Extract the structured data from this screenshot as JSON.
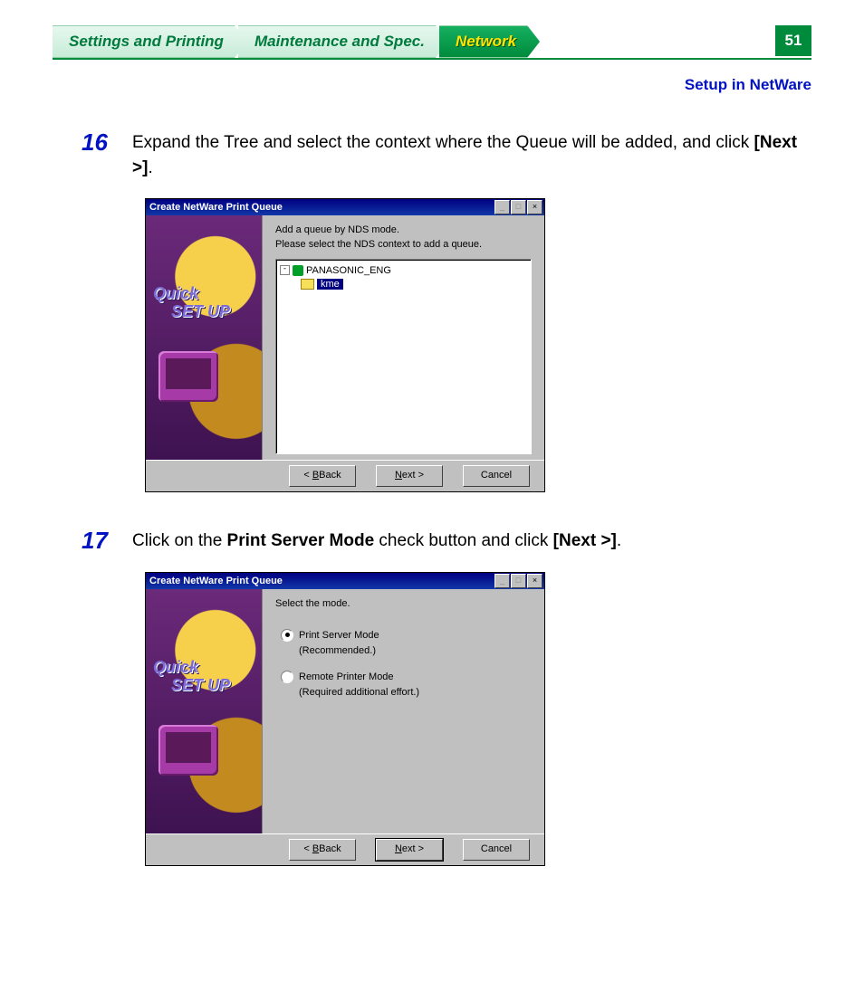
{
  "header": {
    "tabs": [
      {
        "label": "Settings and Printing"
      },
      {
        "label": "Maintenance and Spec."
      },
      {
        "label": "Network"
      }
    ],
    "page_number": "51",
    "section_title": "Setup in NetWare"
  },
  "steps": [
    {
      "num": "16",
      "pre": "Expand the Tree and select the context where the Queue will be added, and click ",
      "bold": "[Next >]",
      "post": "."
    },
    {
      "num": "17",
      "pre": "Click on the ",
      "bold": "Print Server Mode",
      "mid": " check button and click ",
      "bold2": "[Next >]",
      "post": "."
    }
  ],
  "dialog1": {
    "title": "Create NetWare Print Queue",
    "min": "_",
    "max": "□",
    "close": "×",
    "side_quick": "Quick",
    "side_setup": "SET UP",
    "instr_line1": "Add a queue by NDS mode.",
    "instr_line2": "Please select the NDS context to add a queue.",
    "tree_toggle": "-",
    "tree_root": "PANASONIC_ENG",
    "tree_child": "kme",
    "btn_back": "Back",
    "btn_back_pre": "< ",
    "btn_next": "ext >",
    "btn_next_pre": "N",
    "btn_cancel": "Cancel"
  },
  "dialog2": {
    "title": "Create NetWare Print Queue",
    "min": "_",
    "max": "□",
    "close": "×",
    "side_quick": "Quick",
    "side_setup": "SET UP",
    "instr_line1": "Select the mode.",
    "radio1_label": "Print Server Mode",
    "radio1_sub": "(Recommended.)",
    "radio2_label": "Remote Printer Mode",
    "radio2_sub": "(Required additional effort.)",
    "btn_back": "Back",
    "btn_back_pre": "< ",
    "btn_next": "ext >",
    "btn_next_pre": "N",
    "btn_cancel": "Cancel"
  }
}
